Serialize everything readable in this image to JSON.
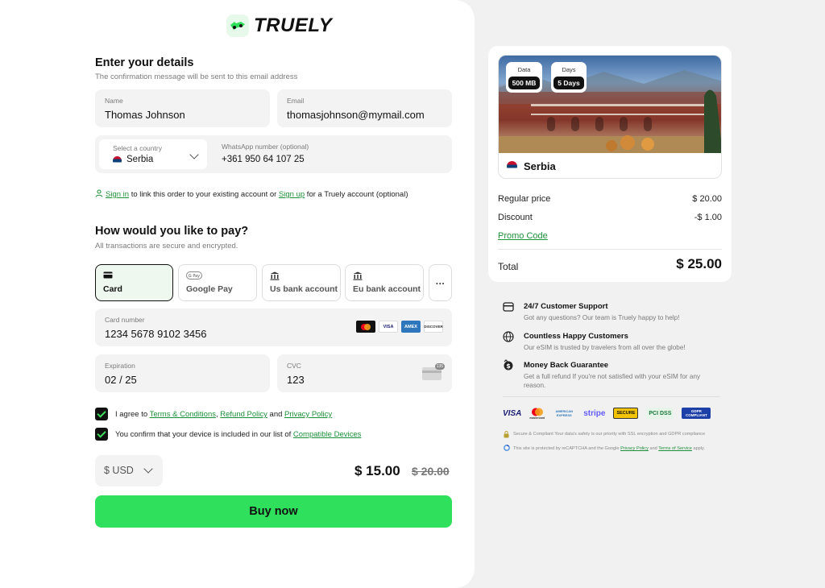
{
  "brand": {
    "name": "TRUELY",
    "accent": "#2fe05c",
    "link_color": "#1e8f3a"
  },
  "details": {
    "heading": "Enter your details",
    "subheading": "The confirmation message will be sent to this email address",
    "name": {
      "label": "Name",
      "value": "Thomas Johnson"
    },
    "email": {
      "label": "Email",
      "value": "thomasjohnson@mymail.com"
    },
    "country": {
      "label": "Select a country",
      "value": "Serbia"
    },
    "whatsapp": {
      "label": "WhatsApp number (optional)",
      "value": "+361 950 64 107 25"
    },
    "signin": {
      "signin_link": "Sign in",
      "middle": " to link this order to your existing account or ",
      "signup_link": "Sign up",
      "tail": " for a Truely account (optional)"
    }
  },
  "payment": {
    "heading": "How would you like to pay?",
    "subheading": "All transactions are secure and encrypted.",
    "methods": [
      {
        "label": "Card",
        "icon": "card-icon",
        "selected": true
      },
      {
        "label": "Google Pay",
        "icon": "google-pay-icon",
        "selected": false
      },
      {
        "label": "Us bank account",
        "icon": "bank-icon",
        "selected": false
      },
      {
        "label": "Eu bank account",
        "icon": "bank-icon",
        "selected": false
      }
    ],
    "more": "...",
    "card_number": {
      "label": "Card number",
      "value": "1234 5678 9102 3456"
    },
    "card_brands": [
      "Mastercard",
      "VISA",
      "AMEX",
      "DISCOVER"
    ],
    "expiration": {
      "label": "Expiration",
      "value": "02 / 25"
    },
    "cvc": {
      "label": "CVC",
      "value": "123",
      "card_hint": "135"
    }
  },
  "agreements": {
    "terms": {
      "prefix": "I agree to ",
      "terms_link": "Terms & Conditions",
      "sep": ", ",
      "refund_link": "Refund Policy",
      "and": " and ",
      "privacy_link": "Privacy Policy"
    },
    "devices": {
      "prefix": "You confirm that your device is included in our list of ",
      "link": "Compatible Devices"
    }
  },
  "checkout": {
    "currency": "$ USD",
    "price": "$ 15.00",
    "old_price": "$ 20.00",
    "buy_label": "Buy now"
  },
  "summary": {
    "product": {
      "data_label": "Data",
      "data_value": "500 MB",
      "days_label": "Days",
      "days_value": "5 Days",
      "country": "Serbia"
    },
    "regular_price": {
      "label": "Regular price",
      "value": "$ 20.00"
    },
    "discount": {
      "label": "Discount",
      "value": "-$ 1.00"
    },
    "promo_link": "Promo Code",
    "total": {
      "label": "Total",
      "value": "$ 25.00"
    }
  },
  "features": [
    {
      "icon": "support-icon",
      "title": "24/7 Customer Support",
      "desc": "Got any questions? Our team is Truely happy to help!"
    },
    {
      "icon": "globe-icon",
      "title": "Countless Happy Customers",
      "desc": "Our eSIM is trusted by travelers from all over the globe!"
    },
    {
      "icon": "money-back-icon",
      "title": "Money Back Guarantee",
      "desc": "Get a full refund If you're not satisfied with your eSIM for any reason."
    }
  ],
  "trust_badges": [
    "VISA",
    "mastercard",
    "AMERICAN EXPRESS",
    "stripe",
    "SECURE",
    "PCI DSS",
    "GDPR COMPLIANT"
  ],
  "fine_print": {
    "secure": "Secure & Compliant Your data's safety is our priority with SSL encryption and GDPR compliance",
    "recaptcha_prefix": "This site is protected by reCAPTCHA and the Google ",
    "privacy_link": "Privacy Policy",
    "and": " and ",
    "terms_link": "Terms of Service",
    "suffix": " apply."
  }
}
